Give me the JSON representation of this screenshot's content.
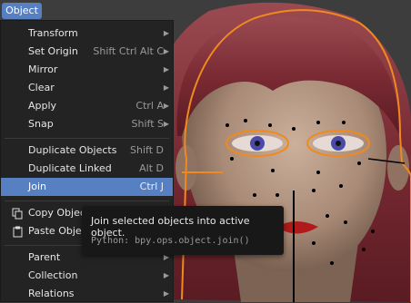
{
  "header": {
    "menu_label": "Object"
  },
  "menu": {
    "items": [
      {
        "label": "Transform",
        "shortcut": "",
        "submenu": true
      },
      {
        "label": "Set Origin",
        "shortcut": "Shift Ctrl Alt C",
        "submenu": true
      },
      {
        "label": "Mirror",
        "shortcut": "",
        "submenu": true
      },
      {
        "label": "Clear",
        "shortcut": "",
        "submenu": true
      },
      {
        "label": "Apply",
        "shortcut": "Ctrl A",
        "submenu": true
      },
      {
        "label": "Snap",
        "shortcut": "Shift S",
        "submenu": true
      },
      {
        "label": "Duplicate Objects",
        "shortcut": "Shift D",
        "submenu": false
      },
      {
        "label": "Duplicate Linked",
        "shortcut": "Alt D",
        "submenu": false
      },
      {
        "label": "Join",
        "shortcut": "Ctrl J",
        "submenu": false,
        "active": true
      },
      {
        "label": "Copy Object",
        "shortcut": "",
        "submenu": false
      },
      {
        "label": "Paste Object",
        "shortcut": "",
        "submenu": false
      },
      {
        "label": "Parent",
        "shortcut": "",
        "submenu": true
      },
      {
        "label": "Collection",
        "shortcut": "",
        "submenu": true
      },
      {
        "label": "Relations",
        "shortcut": "",
        "submenu": true
      }
    ]
  },
  "tooltip": {
    "text": "Join selected objects into active object.",
    "python": "Python: bpy.ops.object.join()"
  },
  "colors": {
    "accent": "#5680c2",
    "menu_bg": "#232323",
    "outline": "#f08a1e"
  }
}
